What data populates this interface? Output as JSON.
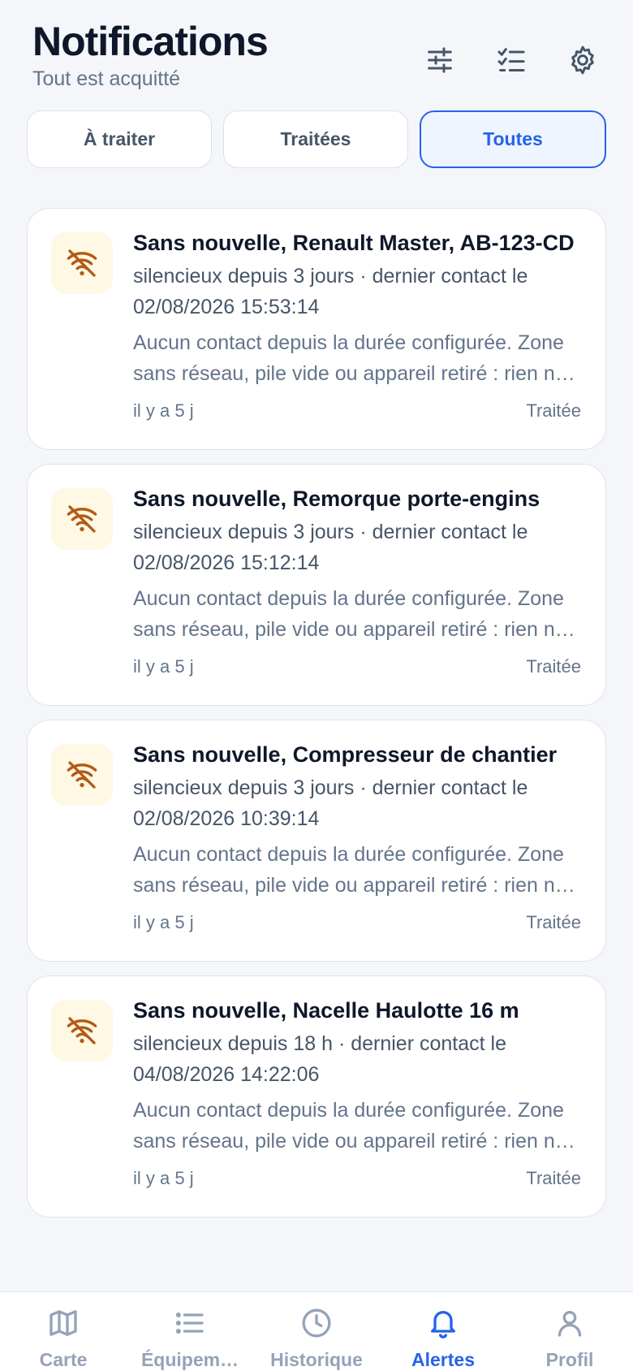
{
  "header": {
    "title": "Notifications",
    "subtitle": "Tout est acquitté",
    "icons": [
      "sliders-icon",
      "checklist-icon",
      "gear-icon"
    ]
  },
  "tabs": [
    {
      "label": "À traiter",
      "active": false
    },
    {
      "label": "Traitées",
      "active": false
    },
    {
      "label": "Toutes",
      "active": true
    }
  ],
  "notifications": [
    {
      "icon": "wifi-off-icon",
      "title": "Sans nouvelle, Renault Master, AB-123-CD",
      "subtitle": "silencieux depuis 3 jours · dernier contact le 02/08/2026 15:53:14",
      "body": "Aucun contact depuis la durée configurée. Zone sans réseau, pile vide ou appareil retiré : rien ne permet de le déterminer.",
      "time": "il y a 5 j",
      "status": "Traitée"
    },
    {
      "icon": "wifi-off-icon",
      "title": "Sans nouvelle, Remorque porte-engins",
      "subtitle": "silencieux depuis 3 jours · dernier contact le 02/08/2026 15:12:14",
      "body": "Aucun contact depuis la durée configurée. Zone sans réseau, pile vide ou appareil retiré : rien ne permet de le déterminer.",
      "time": "il y a 5 j",
      "status": "Traitée"
    },
    {
      "icon": "wifi-off-icon",
      "title": "Sans nouvelle, Compresseur de chantier",
      "subtitle": "silencieux depuis 3 jours · dernier contact le 02/08/2026 10:39:14",
      "body": "Aucun contact depuis la durée configurée. Zone sans réseau, pile vide ou appareil retiré : rien ne permet de le déterminer.",
      "time": "il y a 5 j",
      "status": "Traitée"
    },
    {
      "icon": "wifi-off-icon",
      "title": "Sans nouvelle, Nacelle Haulotte 16 m",
      "subtitle": "silencieux depuis 18 h · dernier contact le 04/08/2026 14:22:06",
      "body": "Aucun contact depuis la durée configurée. Zone sans réseau, pile vide ou appareil retiré : rien ne permet de le déterminer.",
      "time": "il y a 5 j",
      "status": "Traitée"
    }
  ],
  "nav": [
    {
      "label": "Carte",
      "icon": "map-icon",
      "active": false
    },
    {
      "label": "Équipem…",
      "icon": "list-icon",
      "active": false
    },
    {
      "label": "Historique",
      "icon": "clock-icon",
      "active": false
    },
    {
      "label": "Alertes",
      "icon": "bell-icon",
      "active": true
    },
    {
      "label": "Profil",
      "icon": "user-icon",
      "active": false
    }
  ],
  "colors": {
    "accent": "#2563eb",
    "warning_icon": "#b45a13",
    "warning_bg": "#fef8e4"
  }
}
